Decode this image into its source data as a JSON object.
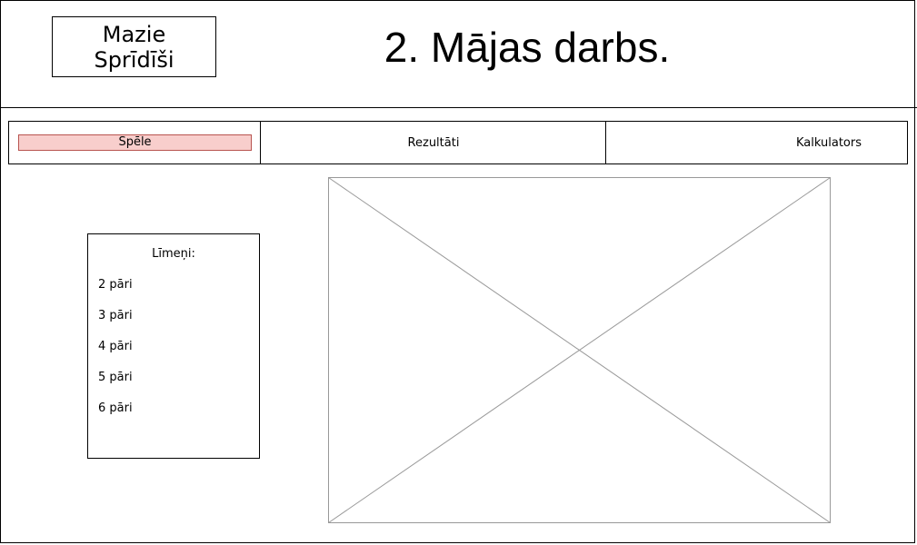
{
  "header": {
    "logo_text": [
      "Mazie",
      "Sprīdīši"
    ],
    "title": "2. Mājas darbs."
  },
  "nav": {
    "tabs": [
      {
        "label": "Spēle",
        "active": true
      },
      {
        "label": "Rezultāti",
        "active": false
      },
      {
        "label": "Kalkulators",
        "active": false
      }
    ],
    "active_color": "#f8cecc"
  },
  "levels": {
    "title": "Līmeņi:",
    "items": [
      "2 pāri",
      "3 pāri",
      "4 pāri",
      "5 pāri",
      "6 pāri"
    ]
  },
  "image_placeholder": {
    "icon": "image-placeholder-icon"
  }
}
